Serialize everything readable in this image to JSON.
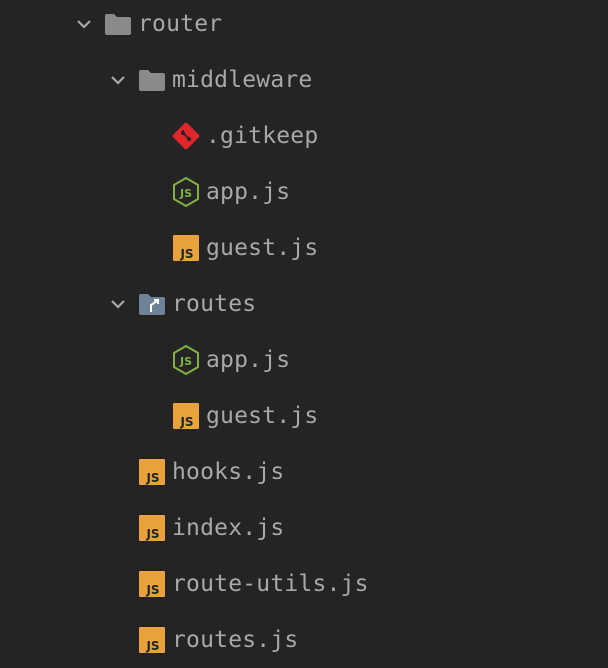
{
  "tree": {
    "router": {
      "label": "router",
      "icon": "folder-icon",
      "expanded": true,
      "middleware": {
        "label": "middleware",
        "icon": "folder-icon",
        "expanded": true,
        "files": [
          {
            "label": ".gitkeep",
            "icon": "git-icon"
          },
          {
            "label": "app.js",
            "icon": "nodejs-icon"
          },
          {
            "label": "guest.js",
            "icon": "js-icon"
          }
        ]
      },
      "routes": {
        "label": "routes",
        "icon": "routes-folder-icon",
        "expanded": true,
        "files": [
          {
            "label": "app.js",
            "icon": "nodejs-icon"
          },
          {
            "label": "guest.js",
            "icon": "js-icon"
          }
        ]
      },
      "files": [
        {
          "label": "hooks.js",
          "icon": "js-icon"
        },
        {
          "label": "index.js",
          "icon": "js-icon"
        },
        {
          "label": "route-utils.js",
          "icon": "js-icon"
        },
        {
          "label": "routes.js",
          "icon": "js-icon"
        }
      ]
    }
  },
  "colors": {
    "background": "#242424",
    "text": "#a8a8a8",
    "js_badge": "#e8a33d",
    "node_green": "#7cb342",
    "git_red": "#e0262b",
    "folder_grey": "#8a8a8a",
    "routes_blue": "#90a8c0"
  }
}
